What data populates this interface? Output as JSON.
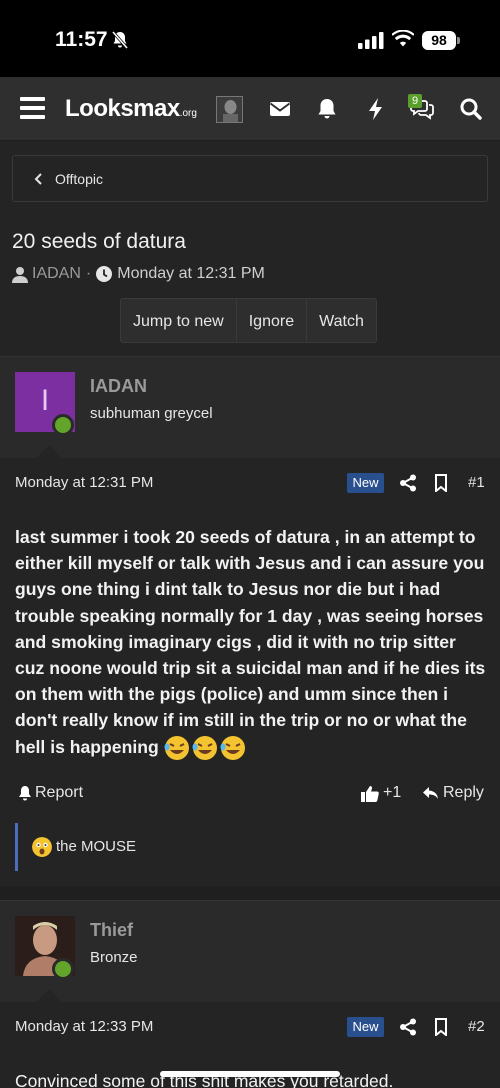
{
  "status_bar": {
    "time": "11:57",
    "battery": "98"
  },
  "nav": {
    "logo_main": "Looksmax",
    "logo_suffix": ".org",
    "icons": [
      "menu-icon",
      "avatar",
      "envelope-icon",
      "bell-icon",
      "bolt-icon",
      "chat-icon",
      "search-icon"
    ],
    "chat_badge": "9"
  },
  "breadcrumb": {
    "label": "Offtopic"
  },
  "thread": {
    "title": "20 seeds of datura",
    "author": "IADAN",
    "date": "Monday at 12:31 PM",
    "buttons": {
      "jump": "Jump to new",
      "ignore": "Ignore",
      "watch": "Watch"
    }
  },
  "posts": [
    {
      "avatar_letter": "I",
      "username": "IADAN",
      "user_title": "subhuman greycel",
      "date": "Monday at 12:31 PM",
      "badge": "New",
      "number": "#1",
      "text": "last summer i took 20 seeds of datura , in an attempt to either kill myself or talk with Jesus and i can assure you guys one thing i dint talk to Jesus nor die but i had trouble speaking normally for 1 day , was seeing horses and smoking imaginary cigs , did it with no trip sitter cuz noone would trip sit a suicidal man and if he dies its on them with the pigs (police) and umm since then i don't really know if im still in the trip or no or what the hell is happening",
      "report_label": "Report",
      "like_count": "+1",
      "reply_label": "Reply",
      "reaction_user": "the MOUSE"
    },
    {
      "username": "Thief",
      "user_title": "Bronze",
      "date": "Monday at 12:33 PM",
      "badge": "New",
      "number": "#2",
      "text": "Convinced some of this shit makes you retarded."
    }
  ],
  "colors": {
    "background": "#242424",
    "accent_blue": "#2a4f8f",
    "online_green": "#63a52b",
    "avatar_purple": "#7b2fa0"
  }
}
